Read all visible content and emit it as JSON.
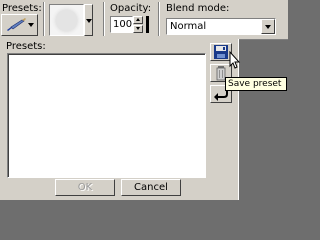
{
  "toolbar": {
    "presets_label": "Presets:",
    "opacity_label": "Opacity:",
    "opacity_value": "100",
    "blend_label": "Blend mode:",
    "blend_value": "Normal"
  },
  "panel": {
    "presets_label": "Presets:",
    "ok_label": "OK",
    "cancel_label": "Cancel"
  },
  "tooltip": {
    "text": "Save preset"
  },
  "icons": {
    "presets": "paintbrush-icon",
    "save": "floppy-disk-icon",
    "delete": "trash-icon",
    "reset": "undo-arrow-icon"
  },
  "colors": {
    "face": "#d4d0c8",
    "workspace": "#6e6e6e",
    "tooltip_bg": "#ffffe1"
  }
}
